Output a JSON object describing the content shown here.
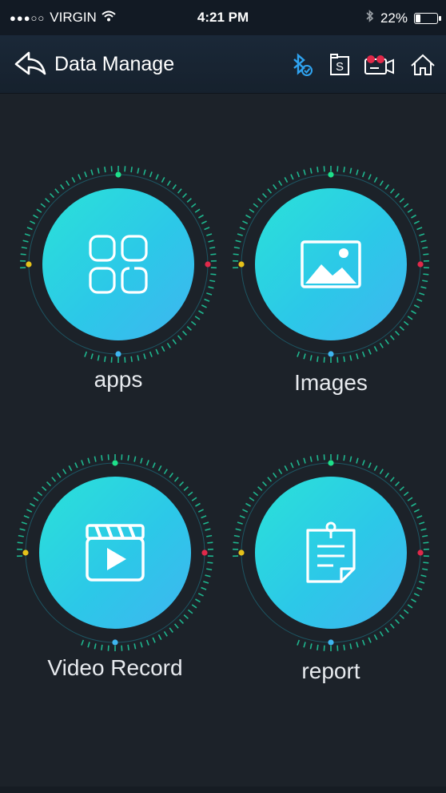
{
  "status_bar": {
    "signal": "●●●○○",
    "carrier": "VIRGIN",
    "time": "4:21 PM",
    "battery_text": "22%",
    "battery_level": 0.22
  },
  "nav": {
    "title": "Data Manage",
    "icons": [
      "back-arrow-icon",
      "bluetooth-connected-icon",
      "s-document-icon",
      "record-camera-icon",
      "home-icon"
    ],
    "accent_color": "#2fa3f0"
  },
  "tiles": [
    {
      "id": "apps",
      "label": "apps",
      "icon": "apps-grid-icon"
    },
    {
      "id": "images",
      "label": "Images",
      "icon": "image-icon"
    },
    {
      "id": "video-record",
      "label": "Video Record",
      "icon": "video-clapper-icon"
    },
    {
      "id": "report",
      "label": "report",
      "icon": "report-clipboard-icon"
    }
  ],
  "colors": {
    "background": "#1c2229",
    "circle_start": "#2ae2d8",
    "circle_end": "#3fb5f0",
    "dot_top": "#1ee08a",
    "dot_right": "#e0294a",
    "dot_bottom": "#3fb5f0",
    "dot_left": "#e6c21a"
  }
}
